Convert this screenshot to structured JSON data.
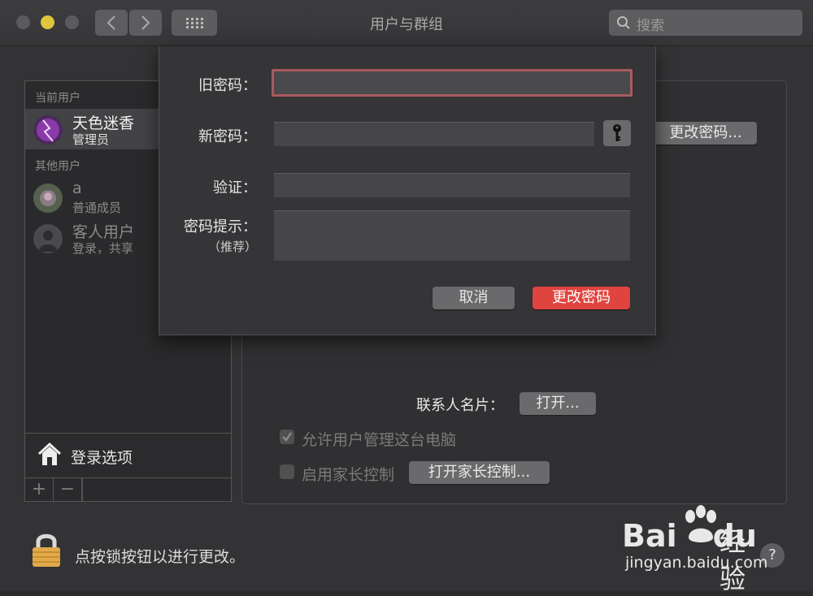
{
  "window": {
    "title": "用户与群组"
  },
  "toolbar": {
    "search_placeholder": "搜索"
  },
  "sidebar": {
    "current_header": "当前用户",
    "current_user": {
      "name": "天色迷香",
      "role": "管理员"
    },
    "others_header": "其他用户",
    "other_users": [
      {
        "name": "a",
        "role": "普通成员"
      },
      {
        "name": "客人用户",
        "role": "登录，共享"
      }
    ],
    "login_options": "登录选项",
    "add_label": "+",
    "remove_label": "−"
  },
  "pane": {
    "change_password_button": "更改密码...",
    "contact_card_label": "联系人名片：",
    "open_button": "打开...",
    "allow_admin_label": "允许用户管理这台电脑",
    "allow_admin_checked": true,
    "parental_label": "启用家长控制",
    "parental_checked": false,
    "open_parental_button": "打开家长控制..."
  },
  "sheet": {
    "old_password_label": "旧密码：",
    "new_password_label": "新密码：",
    "verify_label": "验证：",
    "hint_label": "密码提示：",
    "hint_sub": "（推荐）",
    "old_password_value": "",
    "new_password_value": "",
    "verify_value": "",
    "hint_value": "",
    "cancel_button": "取消",
    "confirm_button": "更改密码"
  },
  "footer": {
    "lock_text": "点按锁按钮以进行更改。",
    "help": "?"
  },
  "watermark": {
    "brand": "Bai",
    "brand2": "du",
    "jingyan": "经验",
    "url": "jingyan.baidu.com"
  },
  "colors": {
    "accent_red": "#e0443e",
    "focus_ring": "#a85a5f",
    "min_yellow": "#e0c43a"
  }
}
